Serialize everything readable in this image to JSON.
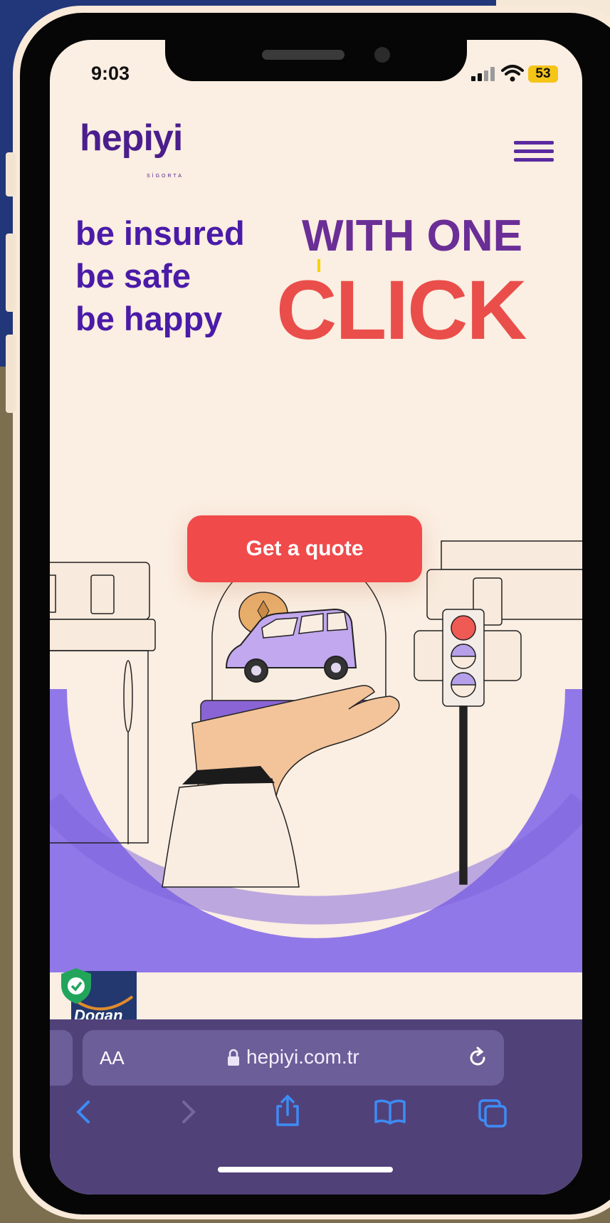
{
  "status_bar": {
    "time": "9:03",
    "battery": "53"
  },
  "brand": {
    "logo": "hepiyi",
    "logo_subtitle": "SİGORTA",
    "primary_color": "#4a1ba8",
    "accent_color": "#ea4e4a"
  },
  "hero": {
    "taglines": [
      "be insured",
      "be safe",
      "be happy"
    ],
    "headline_top": "WITH ONE",
    "headline_bottom": "CLICK"
  },
  "cta": {
    "label": "Get a quote"
  },
  "badge": {
    "partner_text": "Dogan"
  },
  "browser": {
    "text_size_label": "AA",
    "url": "hepiyi.com.tr"
  },
  "icons": [
    "menu-icon",
    "lock-icon",
    "reload-icon",
    "back-icon",
    "forward-icon",
    "share-icon",
    "bookmarks-icon",
    "tabs-icon",
    "wifi-icon",
    "signal-icon",
    "battery-icon",
    "shield-check-icon"
  ]
}
